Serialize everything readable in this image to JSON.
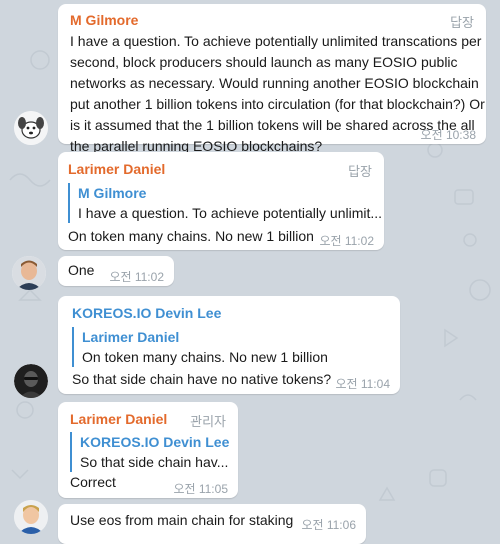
{
  "colors": {
    "chat_bg": "#cfd6dd",
    "bubble": "#ffffff",
    "name_orange": "#e36a2c",
    "name_blue": "#3f8fd2",
    "meta_gray": "#9aa3ab"
  },
  "messages": [
    {
      "sender": "M Gilmore",
      "sender_color": "#e36a2c",
      "tag": "답장",
      "lines": [
        "I have a question. To achieve potentially unlimited transcations per",
        "second, block producers should launch as many EOSIO public",
        "networks as necessary. Would running another EOSIO blockchain",
        "put another 1 billion tokens into circulation (for that blockchain?) Or",
        "is it assumed that the 1 billion tokens will be shared across the all",
        "the parallel running EOSIO blockchains?"
      ],
      "time": "오전 10:38"
    },
    {
      "sender": "Larimer Daniel",
      "sender_color": "#e36a2c",
      "tag": "답장",
      "reply_to": {
        "name": "M Gilmore",
        "text": "I have a question. To achieve potentially unlimit..."
      },
      "text": "On token many chains. No new 1 billion",
      "time": "오전 11:02"
    },
    {
      "text": "One",
      "time": "오전 11:02"
    },
    {
      "sender": "KOREOS.IO Devin Lee",
      "sender_color": "#3f8fd2",
      "reply_to": {
        "name": "Larimer Daniel",
        "text": "On token many chains. No new 1 billion"
      },
      "text": "So that side chain have no native tokens?",
      "time": "오전 11:04"
    },
    {
      "sender": "Larimer Daniel",
      "sender_color": "#e36a2c",
      "tag": "관리자",
      "reply_to": {
        "name": "KOREOS.IO Devin Lee",
        "text": "So that side chain hav..."
      },
      "text": "Correct",
      "time": "오전 11:05"
    },
    {
      "text": "Use eos from main chain for staking",
      "time": "오전 11:06"
    }
  ]
}
